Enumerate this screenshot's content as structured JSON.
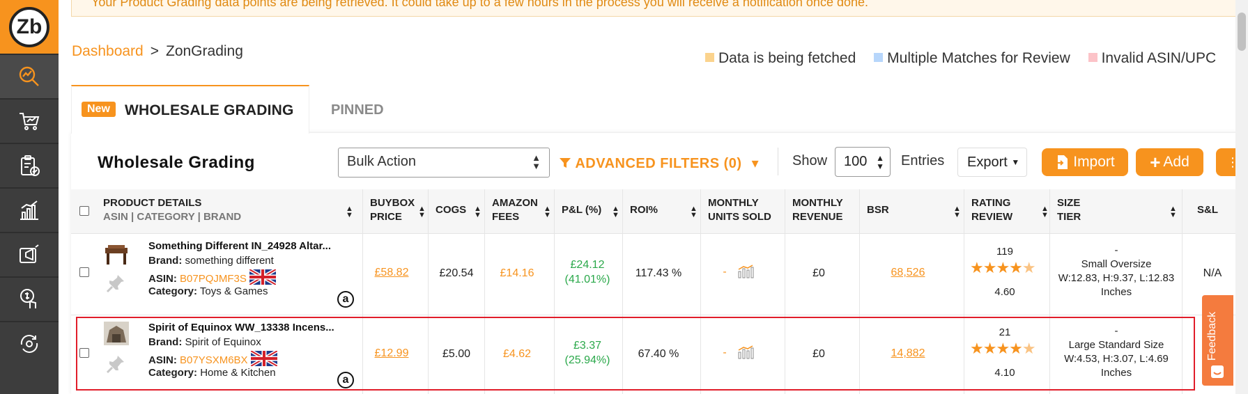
{
  "app": {
    "logo_text": "Zb"
  },
  "notice": {
    "text": "Your Product Grading data points are being retrieved. It could take up to a few hours in the process you will receive a notification once done."
  },
  "sidebar": {
    "items": [
      {
        "icon": "search-chart-icon",
        "active": true
      },
      {
        "icon": "cart-chart-icon"
      },
      {
        "icon": "clipboard-check-icon"
      },
      {
        "icon": "bar-chart-icon"
      },
      {
        "icon": "megaphone-icon"
      },
      {
        "icon": "touch-dollar-icon"
      },
      {
        "icon": "refresh-settings-icon"
      }
    ]
  },
  "breadcrumb": {
    "home": "Dashboard",
    "separator": ">",
    "current": "ZonGrading"
  },
  "legend": [
    {
      "label": "Data is being fetched",
      "color": "#fbd38d"
    },
    {
      "label": "Multiple Matches for Review",
      "color": "#b7d6fb"
    },
    {
      "label": "Invalid ASIN/UPC",
      "color": "#fcc3c8"
    }
  ],
  "tabs": {
    "new_badge": "New",
    "active": "WHOLESALE GRADING",
    "pinned": "PINNED"
  },
  "toolbar": {
    "title": "Wholesale Grading",
    "bulk_action": "Bulk Action",
    "filters": "ADVANCED FILTERS (0)",
    "show": "Show",
    "entries_value": "100",
    "entries": "Entries",
    "export": "Export",
    "import": "Import",
    "add": "Add"
  },
  "table": {
    "headers": {
      "product_line1": "PRODUCT DETAILS",
      "product_line2": "ASIN | CATEGORY | BRAND",
      "buybox_1": "BUYBOX",
      "buybox_2": "PRICE",
      "cogs": "COGS",
      "fees_1": "AMAZON",
      "fees_2": "FEES",
      "pl": "P&L (%)",
      "roi": "ROI%",
      "units_1": "MONTHLY",
      "units_2": "UNITS SOLD",
      "rev_1": "MONTHLY",
      "rev_2": "REVENUE",
      "bsr": "BSR",
      "rating_1": "RATING",
      "rating_2": "REVIEW",
      "size_1": "SIZE",
      "size_2": "TIER",
      "sl": "S&L"
    },
    "labels": {
      "brand": "Brand:",
      "asin": "ASIN:",
      "category": "Category:"
    },
    "rows": [
      {
        "name": "Something Different IN_24928 Altar...",
        "brand": "something different",
        "asin": "B07PQJMF3S",
        "category": "Toys & Games",
        "buybox": "£58.82",
        "cogs": "£20.54",
        "fees": "£14.16",
        "pl": "£24.12",
        "pl_pct": "(41.01%)",
        "roi": "117.43 %",
        "units": "-",
        "revenue": "£0",
        "bsr": "68,526",
        "reviews": "119",
        "rating": "4.60",
        "size_dash": "-",
        "size_tier": "Small Oversize",
        "size_dims": "W:12.83, H:9.37, L:12.83",
        "size_unit": "Inches",
        "sl": "N/A"
      },
      {
        "name": "Spirit of Equinox WW_13338 Incens...",
        "brand": "Spirit of Equinox",
        "asin": "B07YSXM6BX",
        "category": "Home & Kitchen",
        "buybox": "£12.99",
        "cogs": "£5.00",
        "fees": "£4.62",
        "pl": "£3.37",
        "pl_pct": "(25.94%)",
        "roi": "67.40 %",
        "units": "-",
        "revenue": "£0",
        "bsr": "14,882",
        "reviews": "21",
        "rating": "4.10",
        "size_dash": "-",
        "size_tier": "Large Standard Size",
        "size_dims": "W:4.53, H:3.07, L:4.69",
        "size_unit": "Inches"
      }
    ]
  },
  "feedback": {
    "label": "Feedback"
  }
}
